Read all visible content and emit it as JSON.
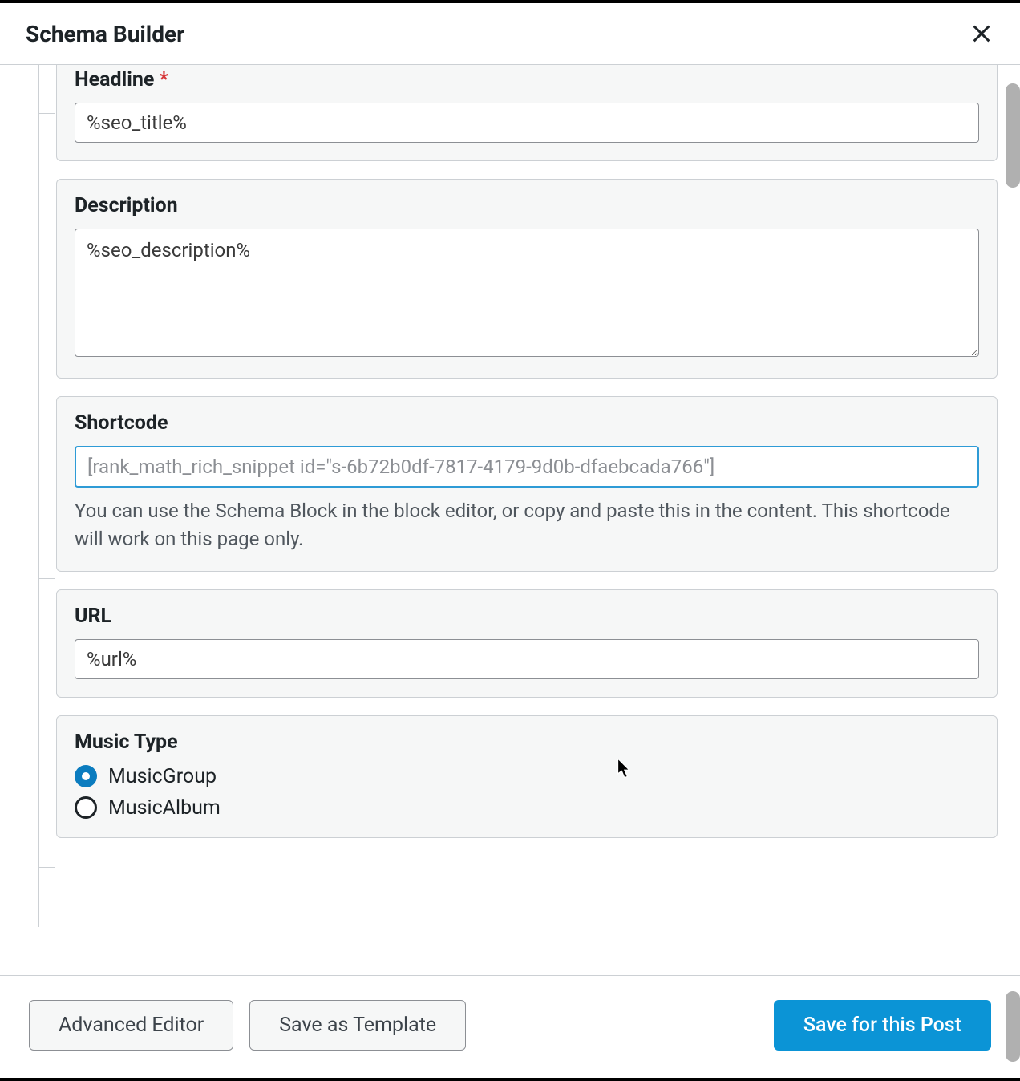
{
  "header": {
    "title": "Schema Builder"
  },
  "fields": {
    "headline": {
      "label": "Headline",
      "required": "*",
      "value": "%seo_title%"
    },
    "description": {
      "label": "Description",
      "value": "%seo_description%"
    },
    "shortcode": {
      "label": "Shortcode",
      "value": "[rank_math_rich_snippet id=\"s-6b72b0df-7817-4179-9d0b-dfaebcada766\"]",
      "help": "You can use the Schema Block in the block editor, or copy and paste this in the content. This shortcode will work on this page only."
    },
    "url": {
      "label": "URL",
      "value": "%url%"
    },
    "musicType": {
      "label": "Music Type",
      "options": [
        {
          "label": "MusicGroup",
          "checked": true
        },
        {
          "label": "MusicAlbum",
          "checked": false
        }
      ]
    }
  },
  "footer": {
    "advancedEditor": "Advanced Editor",
    "saveTemplate": "Save as Template",
    "savePost": "Save for this Post"
  }
}
